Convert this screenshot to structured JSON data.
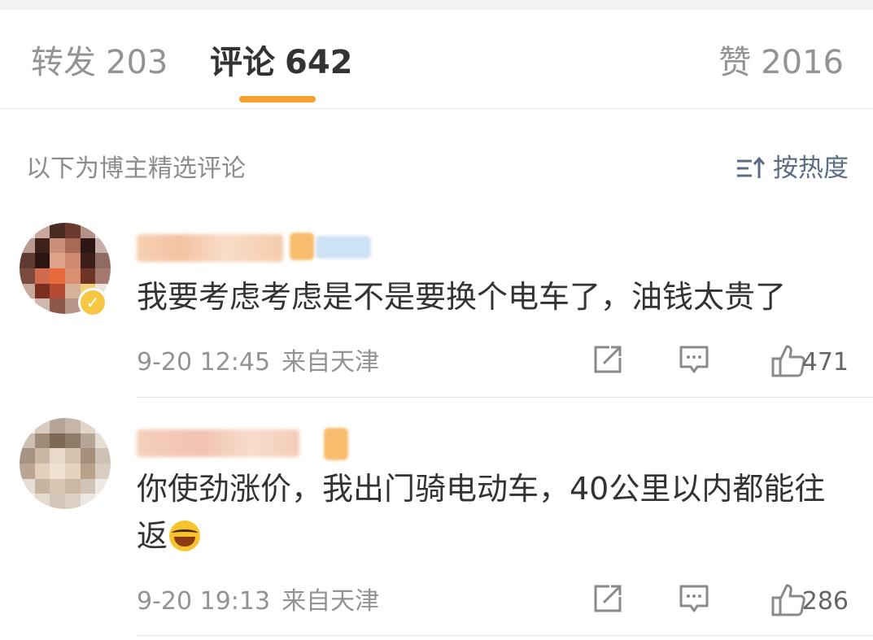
{
  "tabs": {
    "repost": {
      "label": "转发",
      "count": "203"
    },
    "comment": {
      "label": "评论",
      "count": "642"
    },
    "like": {
      "label": "赞",
      "count": "2016"
    }
  },
  "accent_color": "#f5a12e",
  "section": {
    "hint": "以下为博主精选评论",
    "sort_label": "按热度",
    "sort_icon": "sort-descending-icon"
  },
  "comments": [
    {
      "username": "",
      "text": "我要考虑考虑是不是要换个电车了，油钱太贵了",
      "time": "9-20 12:45",
      "location": "来自天津",
      "likes": "471",
      "icons": [
        "share-icon",
        "comment-icon",
        "thumbs-up-icon"
      ]
    },
    {
      "username": "",
      "text": "你使劲涨价，我出门骑电动车，40公里以内都能往返",
      "emoji": "laugh-cry-emoji",
      "time": "9-20 19:13",
      "location": "来自天津",
      "likes": "286",
      "icons": [
        "share-icon",
        "comment-icon",
        "thumbs-up-icon"
      ]
    }
  ]
}
